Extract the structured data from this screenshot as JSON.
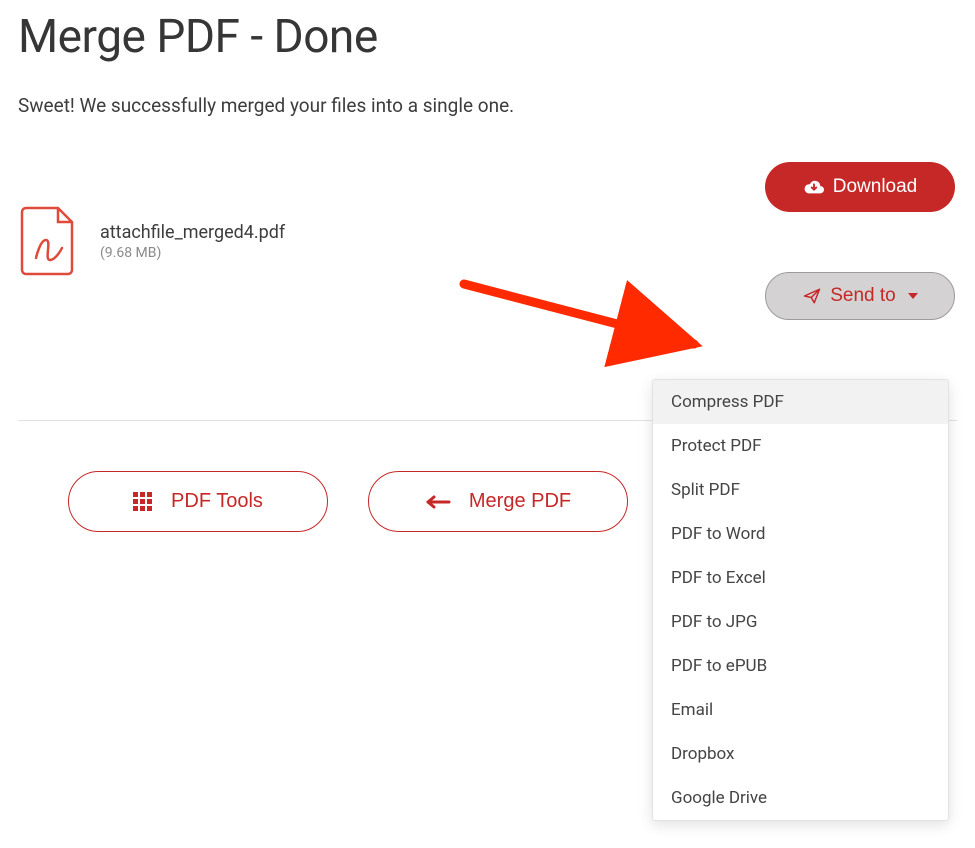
{
  "header": {
    "title": "Merge PDF - Done",
    "subtitle": "Sweet! We successfully merged your files into a single one."
  },
  "file": {
    "name": "attachfile_merged4.pdf",
    "size": "(9.68 MB)"
  },
  "actions": {
    "download": "Download",
    "sendto": "Send to"
  },
  "dropdown": {
    "items": [
      "Compress PDF",
      "Protect PDF",
      "Split PDF",
      "PDF to Word",
      "PDF to Excel",
      "PDF to JPG",
      "PDF to ePUB",
      "Email",
      "Dropbox",
      "Google Drive"
    ]
  },
  "bottom": {
    "tools": "PDF Tools",
    "merge": "Merge PDF"
  }
}
